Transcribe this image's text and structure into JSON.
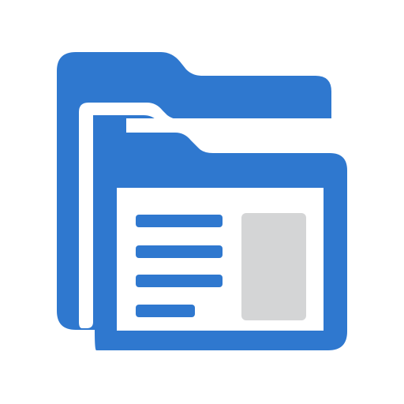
{
  "icon": {
    "name": "folders-document-icon",
    "colors": {
      "folder": "#2f78cf",
      "gap": "#ffffff",
      "document": "#ffffff",
      "text_lines": "#2f78cf",
      "image_placeholder": "#d4d5d6"
    },
    "document": {
      "text_line_count": 4
    }
  }
}
